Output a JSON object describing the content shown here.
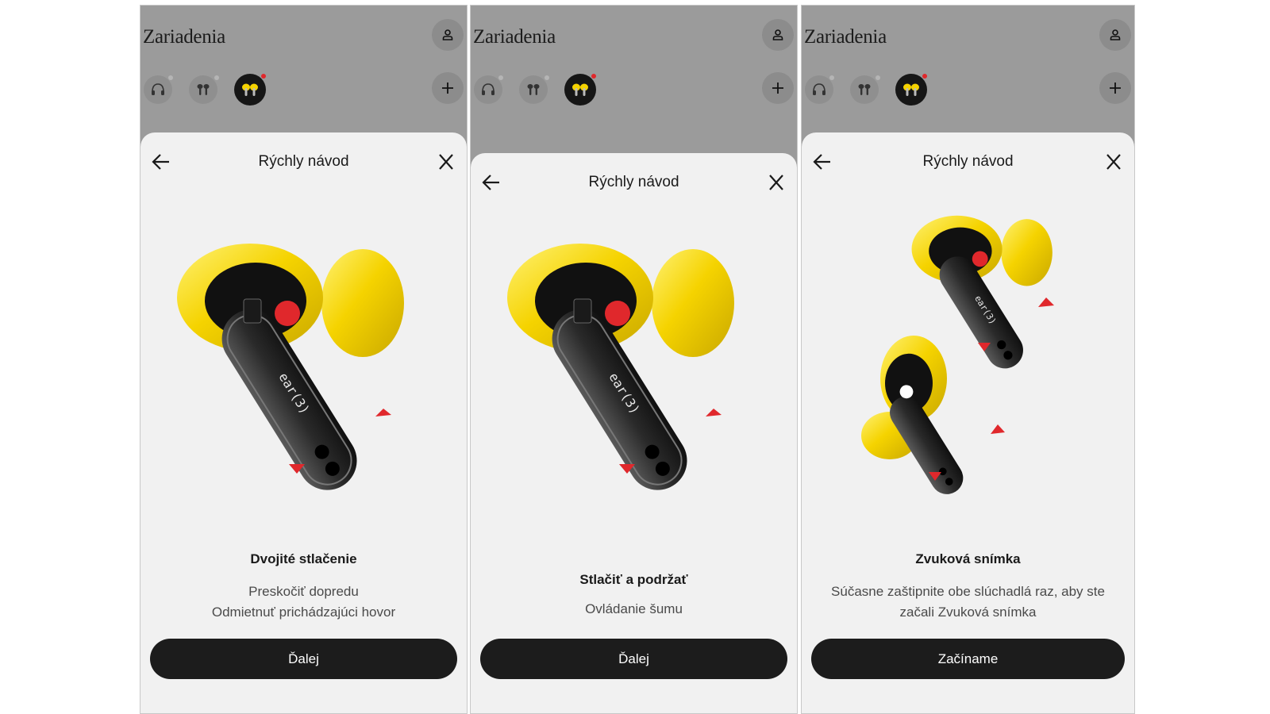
{
  "screens": [
    {
      "app_title": "Zariadenia",
      "sheet_title": "Rýchly návod",
      "gesture": "Dvojité stlačenie",
      "description_lines": [
        "Preskočiť dopredu",
        "Odmietnuť prichádzajúci hovor"
      ],
      "cta": "Ďalej",
      "bud_label": "ear(3)"
    },
    {
      "app_title": "Zariadenia",
      "sheet_title": "Rýchly návod",
      "gesture": "Stlačiť a podržať",
      "description_lines": [
        "Ovládanie šumu"
      ],
      "cta": "Ďalej",
      "bud_label": "ear(3)"
    },
    {
      "app_title": "Zariadenia",
      "sheet_title": "Rýchly návod",
      "gesture": "Zvuková snímka",
      "description_lines": [
        "Súčasne zaštipnite obe slúchadlá raz, aby ste",
        "začali Zvuková snímka"
      ],
      "cta": "Začíname",
      "bud_label": "ear(3)"
    }
  ],
  "colors": {
    "header_background": "#9b9b9b",
    "sheet_background": "#f1f1f1",
    "button_background": "#1c1c1c",
    "accent_red": "#e0282c",
    "earbud_yellow": "#f5d300"
  },
  "icons": {
    "profile": "person-icon",
    "add": "plus-icon",
    "back": "arrow-left-icon",
    "close": "close-icon",
    "devices": [
      "headphones-icon",
      "earbuds-icon",
      "earbuds-yellow-icon"
    ]
  }
}
